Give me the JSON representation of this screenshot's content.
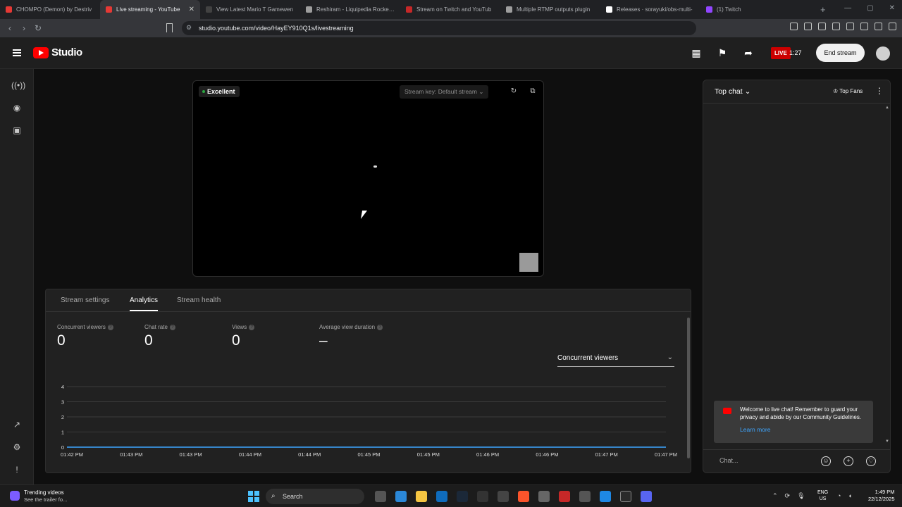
{
  "browser": {
    "tabs": [
      {
        "title": "CHOMPO (Demon) by Destriv",
        "color": "#e53935"
      },
      {
        "title": "Live streaming - YouTube",
        "color": "#e53935",
        "active": true
      },
      {
        "title": "View Latest Mario T Gamewen",
        "color": "#424242"
      },
      {
        "title": "Reshiram - Liquipedia Rocket L",
        "color": "#9e9e9e"
      },
      {
        "title": "Stream on Twitch and YouTub",
        "color": "#c62828"
      },
      {
        "title": "Multiple RTMP outputs plugin",
        "color": "#9e9e9e"
      },
      {
        "title": "Releases · sorayuki/obs-multi-",
        "color": "#ffffff"
      },
      {
        "title": "(1) Twitch",
        "color": "#9146ff"
      }
    ],
    "url": "studio.youtube.com/video/HayEY910Q1s/livestreaming"
  },
  "header": {
    "logo_text": "Studio",
    "live_label": "LIVE",
    "live_time": "1:27",
    "end_stream": "End stream"
  },
  "preview": {
    "quality": "Excellent",
    "stream_key": "Stream key: Default stream"
  },
  "panel": {
    "tabs": [
      "Stream settings",
      "Analytics",
      "Stream health"
    ],
    "active_tab": "Analytics",
    "metrics": [
      {
        "label": "Concurrent viewers",
        "value": "0"
      },
      {
        "label": "Chat rate",
        "value": "0"
      },
      {
        "label": "Views",
        "value": "0"
      },
      {
        "label": "Average view duration",
        "value": "–"
      }
    ],
    "dropdown": "Concurrent viewers"
  },
  "chart_data": {
    "type": "line",
    "title": "",
    "xlabel": "",
    "ylabel": "",
    "x": [
      "01:42 PM",
      "01:43 PM",
      "01:43 PM",
      "01:44 PM",
      "01:44 PM",
      "01:45 PM",
      "01:45 PM",
      "01:46 PM",
      "01:46 PM",
      "01:47 PM",
      "01:47 PM"
    ],
    "series": [
      {
        "values": [
          0,
          0,
          0,
          0,
          0,
          0,
          0,
          0,
          0,
          0,
          0
        ]
      }
    ],
    "yticks": [
      "0",
      "1",
      "2",
      "3",
      "4"
    ],
    "ylim": [
      0,
      4
    ],
    "grid": true,
    "line_color": "#3ea6ff"
  },
  "chat": {
    "title": "Top chat",
    "top_fans": "Top Fans",
    "welcome": "Welcome to live chat! Remember to guard your privacy and abide by our Community Guidelines.",
    "learn_more": "Learn more",
    "input_placeholder": "Chat..."
  },
  "taskbar": {
    "trending_title": "Trending videos",
    "trending_sub": "See the trailer fo...",
    "search": "Search",
    "lang1": "ENG",
    "lang2": "US",
    "time": "1:49 PM",
    "date": "22/12/2025"
  }
}
